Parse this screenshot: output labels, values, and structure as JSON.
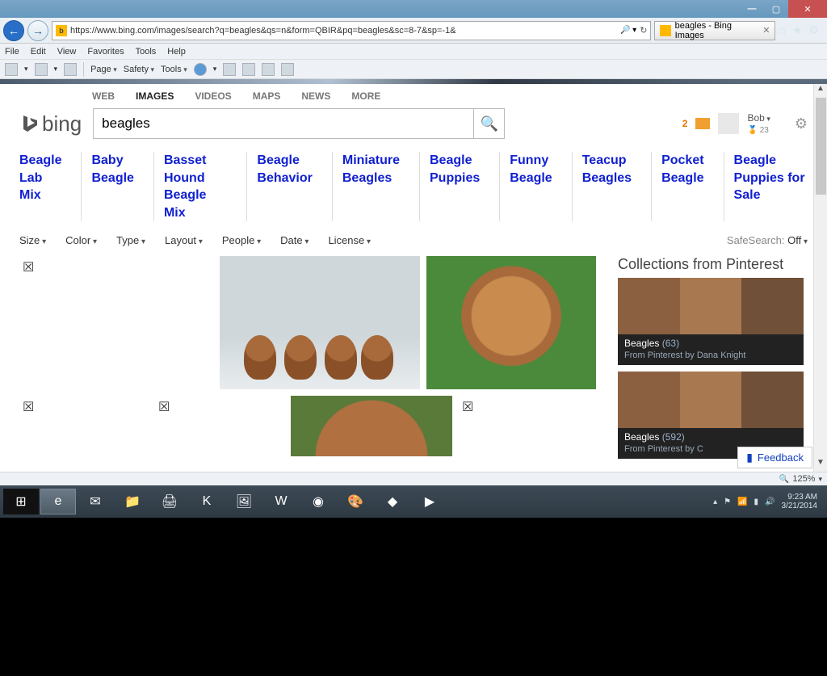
{
  "window": {
    "url": "https://www.bing.com/images/search?q=beagles&qs=n&form=QBIR&pq=beagles&sc=8-7&sp=-1&",
    "tab_title": "beagles - Bing Images"
  },
  "menubar": [
    "File",
    "Edit",
    "View",
    "Favorites",
    "Tools",
    "Help"
  ],
  "cmdbar": {
    "page": "Page",
    "safety": "Safety",
    "tools": "Tools"
  },
  "scope": {
    "web": "WEB",
    "images": "IMAGES",
    "videos": "VIDEOS",
    "maps": "MAPS",
    "news": "NEWS",
    "more": "MORE"
  },
  "logo": "bing",
  "search": {
    "value": "beagles"
  },
  "user": {
    "msg_count": "2",
    "name": "Bob",
    "rewards": "23"
  },
  "related": [
    [
      "Beagle",
      "Lab Mix"
    ],
    [
      "Baby",
      "Beagle"
    ],
    [
      "Basset Hound",
      "Beagle Mix"
    ],
    [
      "Beagle",
      "Behavior"
    ],
    [
      "Miniature",
      "Beagles"
    ],
    [
      "Beagle",
      "Puppies"
    ],
    [
      "Funny",
      "Beagle"
    ],
    [
      "Teacup",
      "Beagles"
    ],
    [
      "Pocket",
      "Beagle"
    ],
    [
      "Beagle",
      "Puppies for Sale"
    ]
  ],
  "filters": {
    "size": "Size",
    "color": "Color",
    "type": "Type",
    "layout": "Layout",
    "people": "People",
    "date": "Date",
    "license": "License",
    "safesearch_label": "SafeSearch:",
    "safesearch_value": "Off"
  },
  "side": {
    "heading": "Collections from Pinterest",
    "cards": [
      {
        "title": "Beagles",
        "count": "(63)",
        "sub": "From Pinterest by Dana Knight"
      },
      {
        "title": "Beagles",
        "count": "(592)",
        "sub": "From Pinterest by C"
      }
    ]
  },
  "feedback": "Feedback",
  "zoom": "125%",
  "clock": {
    "time": "9:23 AM",
    "date": "3/21/2014"
  }
}
